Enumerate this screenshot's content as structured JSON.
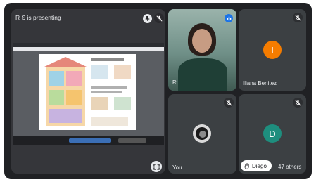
{
  "presentation": {
    "title": "R S is presenting"
  },
  "participants": [
    {
      "name": "R",
      "video": "on",
      "speaking": true
    },
    {
      "name": "Iliana Benitez",
      "initial": "I",
      "avatar_color": "#f57c00",
      "muted": true
    },
    {
      "name": "You",
      "muted": true
    },
    {
      "name": "",
      "initial": "D",
      "avatar_color": "#1e8e7e",
      "muted": true
    }
  ],
  "overflow": {
    "raised_hand_name": "Diego",
    "others_label": "47 others"
  },
  "icons": {
    "mute": "mic-off-icon",
    "speaking": "audio-level-icon",
    "pin": "pin-icon",
    "fullscreen": "fullscreen-icon",
    "hand": "raised-hand-icon"
  },
  "colors": {
    "background": "#202124",
    "tile": "#3c4043",
    "accent": "#8ab4f8"
  }
}
